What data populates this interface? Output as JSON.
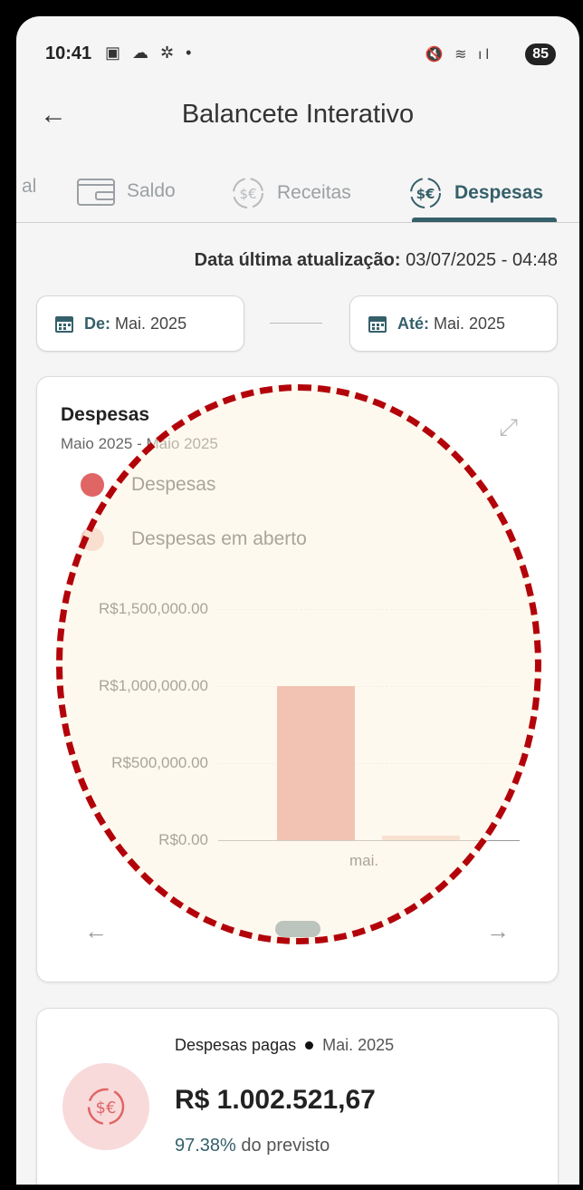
{
  "status_bar": {
    "time": "10:41",
    "battery": "85"
  },
  "app_bar": {
    "title": "Balancete Interativo"
  },
  "tabs": [
    {
      "label": "al"
    },
    {
      "label": "Saldo"
    },
    {
      "label": "Receitas"
    },
    {
      "label": "Despesas",
      "active": true
    }
  ],
  "updated": {
    "label": "Data última atualização:",
    "value": "03/07/2025 - 04:48"
  },
  "filters": {
    "from": {
      "label": "De:",
      "value": "Mai. 2025"
    },
    "to": {
      "label": "Até:",
      "value": "Mai. 2025"
    }
  },
  "chart_card": {
    "title": "Despesas",
    "subtitle": "Maio 2025 - Maio 2025"
  },
  "chart_data": {
    "type": "bar",
    "categories": [
      "mai."
    ],
    "series": [
      {
        "name": "Despesas",
        "values": [
          1002521.67
        ],
        "color": "#e5877a"
      },
      {
        "name": "Despesas em aberto",
        "values": [
          26800
        ],
        "color": "#f1c9bd"
      }
    ],
    "y_ticks": [
      "R$0.00",
      "R$500,000.00",
      "R$1,000,000.00",
      "R$1,500,000.00"
    ],
    "ylim": [
      0,
      1500000
    ],
    "legend": "top-left",
    "grid": true
  },
  "kpi": {
    "label": "Despesas pagas",
    "month": "Mai. 2025",
    "value": "R$ 1.002.521,67",
    "percent": "97.38%",
    "percent_suffix": "do previsto"
  },
  "colors": {
    "accent": "#35606a",
    "overlay_border": "#b3030a"
  }
}
